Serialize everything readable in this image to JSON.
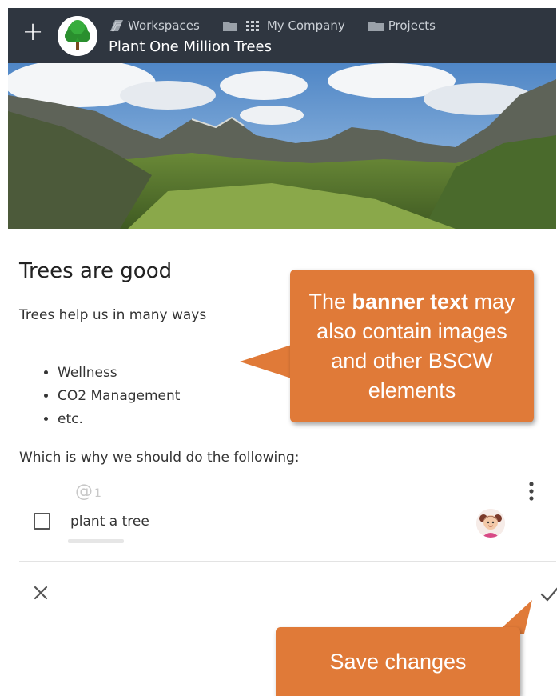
{
  "header": {
    "add_icon": "plus-icon",
    "logo": "tree-logo",
    "breadcrumbs": [
      {
        "label": "Workspaces",
        "icon": "workspaces-icon"
      },
      {
        "label": "My Company",
        "icon": "folder-grid-icon"
      },
      {
        "label": "Projects",
        "icon": "folder-icon"
      }
    ],
    "title": "Plant One Million Trees"
  },
  "banner": {
    "heading": "Trees are good",
    "intro": "Trees help us in many ways",
    "bullets": [
      "Wellness",
      "CO2 Management",
      "etc."
    ],
    "outro": "Which is why we should do the following:"
  },
  "task": {
    "mention_count": "1",
    "label": "plant a tree",
    "checked": false
  },
  "footer": {
    "cancel_icon": "close-icon",
    "save_icon": "checkmark-icon"
  },
  "callouts": {
    "main_pre": "The ",
    "main_bold": "banner text",
    "main_post": " may also contain images and other BSCW elements",
    "save": "Save changes"
  },
  "colors": {
    "topbar": "#2f3640",
    "callout": "#e07a38"
  }
}
